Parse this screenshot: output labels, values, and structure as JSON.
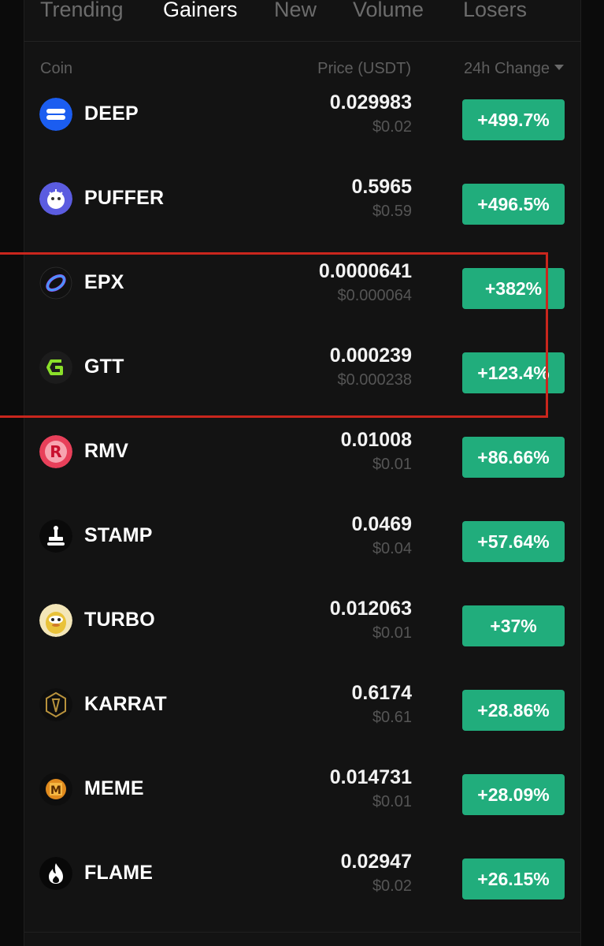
{
  "tabs": [
    {
      "label": "Trending",
      "active": false
    },
    {
      "label": "Gainers",
      "active": true
    },
    {
      "label": "New",
      "active": false
    },
    {
      "label": "Volume",
      "active": false
    },
    {
      "label": "Losers",
      "active": false
    }
  ],
  "columns": {
    "coin": "Coin",
    "price": "Price (USDT)",
    "change": "24h Change"
  },
  "rows": [
    {
      "name": "DEEP",
      "price": "0.029983",
      "price_usd": "$0.02",
      "change": "+499.7%",
      "icon": "deep-icon"
    },
    {
      "name": "PUFFER",
      "price": "0.5965",
      "price_usd": "$0.59",
      "change": "+496.5%",
      "icon": "puffer-icon"
    },
    {
      "name": "EPX",
      "price": "0.0000641",
      "price_usd": "$0.000064",
      "change": "+382%",
      "icon": "epx-icon"
    },
    {
      "name": "GTT",
      "price": "0.000239",
      "price_usd": "$0.000238",
      "change": "+123.4%",
      "icon": "gtt-icon"
    },
    {
      "name": "RMV",
      "price": "0.01008",
      "price_usd": "$0.01",
      "change": "+86.66%",
      "icon": "rmv-icon"
    },
    {
      "name": "STAMP",
      "price": "0.0469",
      "price_usd": "$0.04",
      "change": "+57.64%",
      "icon": "stamp-icon"
    },
    {
      "name": "TURBO",
      "price": "0.012063",
      "price_usd": "$0.01",
      "change": "+37%",
      "icon": "turbo-icon"
    },
    {
      "name": "KARRAT",
      "price": "0.6174",
      "price_usd": "$0.61",
      "change": "+28.86%",
      "icon": "karrat-icon"
    },
    {
      "name": "MEME",
      "price": "0.014731",
      "price_usd": "$0.01",
      "change": "+28.09%",
      "icon": "meme-icon"
    },
    {
      "name": "FLAME",
      "price": "0.02947",
      "price_usd": "$0.02",
      "change": "+26.15%",
      "icon": "flame-icon"
    }
  ],
  "colors": {
    "background": "#131313",
    "change_badge": "#21ad7c",
    "highlight": "#c9261d"
  }
}
